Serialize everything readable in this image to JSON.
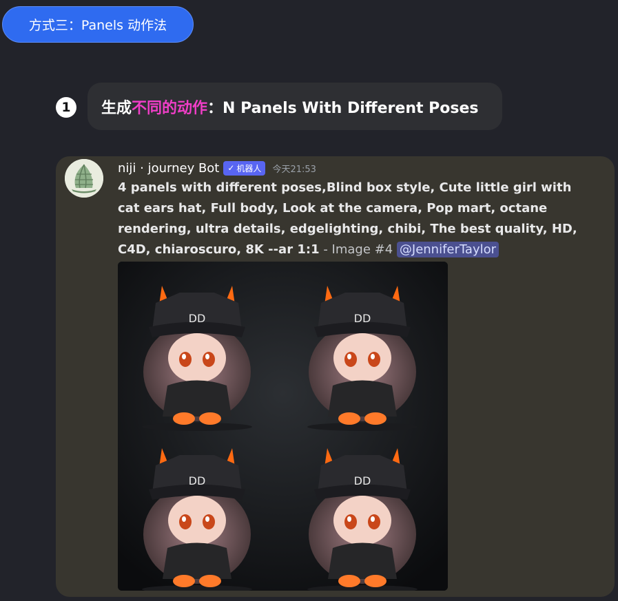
{
  "top_pill": {
    "label": "方式三：Panels 动作法"
  },
  "step": {
    "number": "1",
    "prefix": "生成",
    "highlight": "不同的动作",
    "suffix": "：N Panels With Different Poses"
  },
  "message": {
    "username": "niji · journey Bot",
    "bot_badge": "机器人",
    "timestamp": "今天21:53",
    "prompt": "4 panels with different poses,Blind box style, Cute little girl with cat ears hat, Full body, Look at the camera, Pop mart, octane rendering, ultra details, edgelighting, chibi, The best quality, HD, C4D, chiaroscuro, 8K --ar 1:1",
    "image_suffix": " - Image #4 ",
    "mention": "@JenniferTaylor",
    "avatar_icon": "sailboat-icon",
    "image_alt": "four-panel chibi girl in cat-ear cap figure render"
  },
  "colors": {
    "accent_blue": "#2f6bf0",
    "highlight_pink": "#f03ec7",
    "bot_badge": "#5865f2",
    "message_bg": "#38362f",
    "page_bg": "#22232a"
  }
}
